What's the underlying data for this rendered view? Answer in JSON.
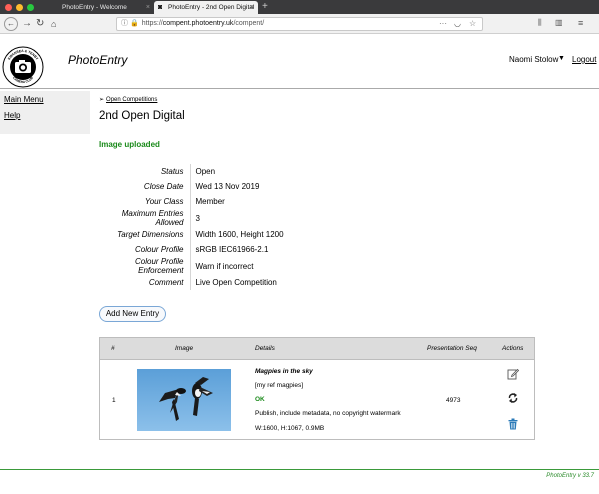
{
  "browser": {
    "tabs": [
      {
        "label": "PhotoEntry - Welcome",
        "active": false
      },
      {
        "label": "PhotoEntry - 2nd Open Digital",
        "active": true
      }
    ],
    "new_tab": "+",
    "close_glyph": "×",
    "url_scheme": "https://",
    "url_host": "compent.photoentry.uk",
    "url_path": "/compent/",
    "icons": [
      "back-icon",
      "forward-icon",
      "reload-icon",
      "home-icon",
      "info-icon",
      "lock-icon",
      "more-icon",
      "pocket-icon",
      "bookmark-icon",
      "library-icon",
      "sidebar-icon",
      "menu-icon"
    ]
  },
  "header": {
    "site_title": "PhotoEntry",
    "user_name": "Naomi Stolow",
    "logout_label": "Logout",
    "logo_text_top": "SWANSEA & TENBY",
    "logo_text_bottom": "CAMERA CLUB"
  },
  "sidebar": {
    "items": [
      {
        "label": "Main Menu"
      },
      {
        "label": "Help"
      }
    ]
  },
  "main": {
    "breadcrumb_arrow": "➢",
    "breadcrumb": "Open Competitions",
    "title": "2nd Open Digital",
    "status_message": "Image uploaded",
    "details": [
      {
        "label": "Status",
        "value": "Open"
      },
      {
        "label": "Close Date",
        "value": "Wed 13 Nov 2019"
      },
      {
        "label": "Your Class",
        "value": "Member"
      },
      {
        "label": "Maximum Entries Allowed",
        "value": "3"
      },
      {
        "label": "Target Dimensions",
        "value": "Width 1600, Height 1200"
      },
      {
        "label": "Colour Profile",
        "value": "sRGB IEC61966-2.1"
      },
      {
        "label": "Colour Profile Enforcement",
        "value": "Warn if incorrect"
      },
      {
        "label": "Comment",
        "value": "Live Open Competition"
      }
    ],
    "add_button": "Add New Entry"
  },
  "entries": {
    "columns": [
      "#",
      "Image",
      "Details",
      "Presentation Seq",
      "Actions"
    ],
    "rows": [
      {
        "num": "1",
        "title": "Magpies in the sky",
        "ref": "[my ref magpies]",
        "status": "OK",
        "options": "Publish, include metadata, no copyright watermark",
        "dims": "W:1600, H:1067, 0.9MB",
        "seq": "4973",
        "actions": [
          "edit-icon",
          "replace-icon",
          "delete-icon"
        ]
      }
    ]
  },
  "footer": {
    "version": "PhotoEntry v 33.7"
  },
  "colors": {
    "accent_green": "#1a8a1a",
    "button_border": "#7aa7d6",
    "action_blue": "#2a7ab8"
  }
}
